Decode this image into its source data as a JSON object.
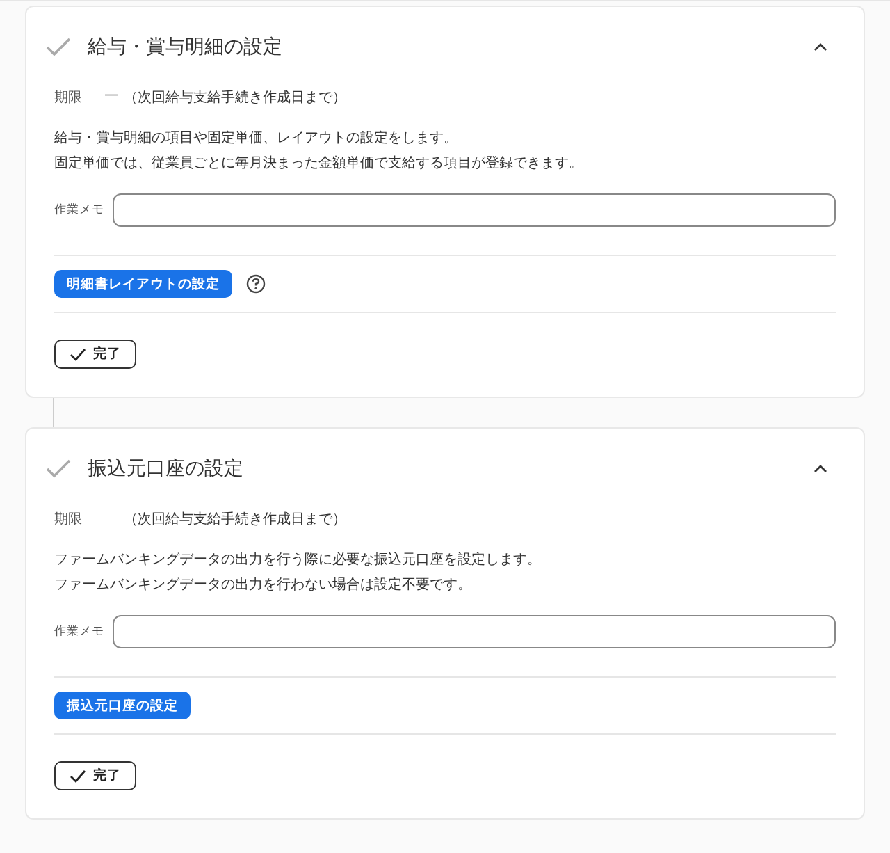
{
  "tasks": [
    {
      "title": "給与・賞与明細の設定",
      "expanded": true,
      "deadline_label": "期限",
      "deadline_value": "—",
      "deadline_note": "（次回給与支給手続き作成日まで）",
      "description": [
        "給与・賞与明細の項目や固定単価、レイアウトの設定をします。",
        "固定単価では、従業員ごとに毎月決まった金額単価で支給する項目が登録できます。"
      ],
      "memo_label": "作業メモ",
      "action": "明細書レイアウトの設定",
      "help": true,
      "done": "完了"
    },
    {
      "title": "振込元口座の設定",
      "expanded": true,
      "deadline_label": "期限",
      "deadline_note": "（次回給与支給手続き作成日まで）",
      "description": [
        "ファームバンキングデータの出力を行う際に必要な振込元口座を設定します。",
        "ファームバンキングデータの出力を行わない場合は設定不要です。"
      ],
      "memo_label": "作業メモ",
      "action": "振込元口座の設定",
      "help": false,
      "done": "完了"
    }
  ]
}
